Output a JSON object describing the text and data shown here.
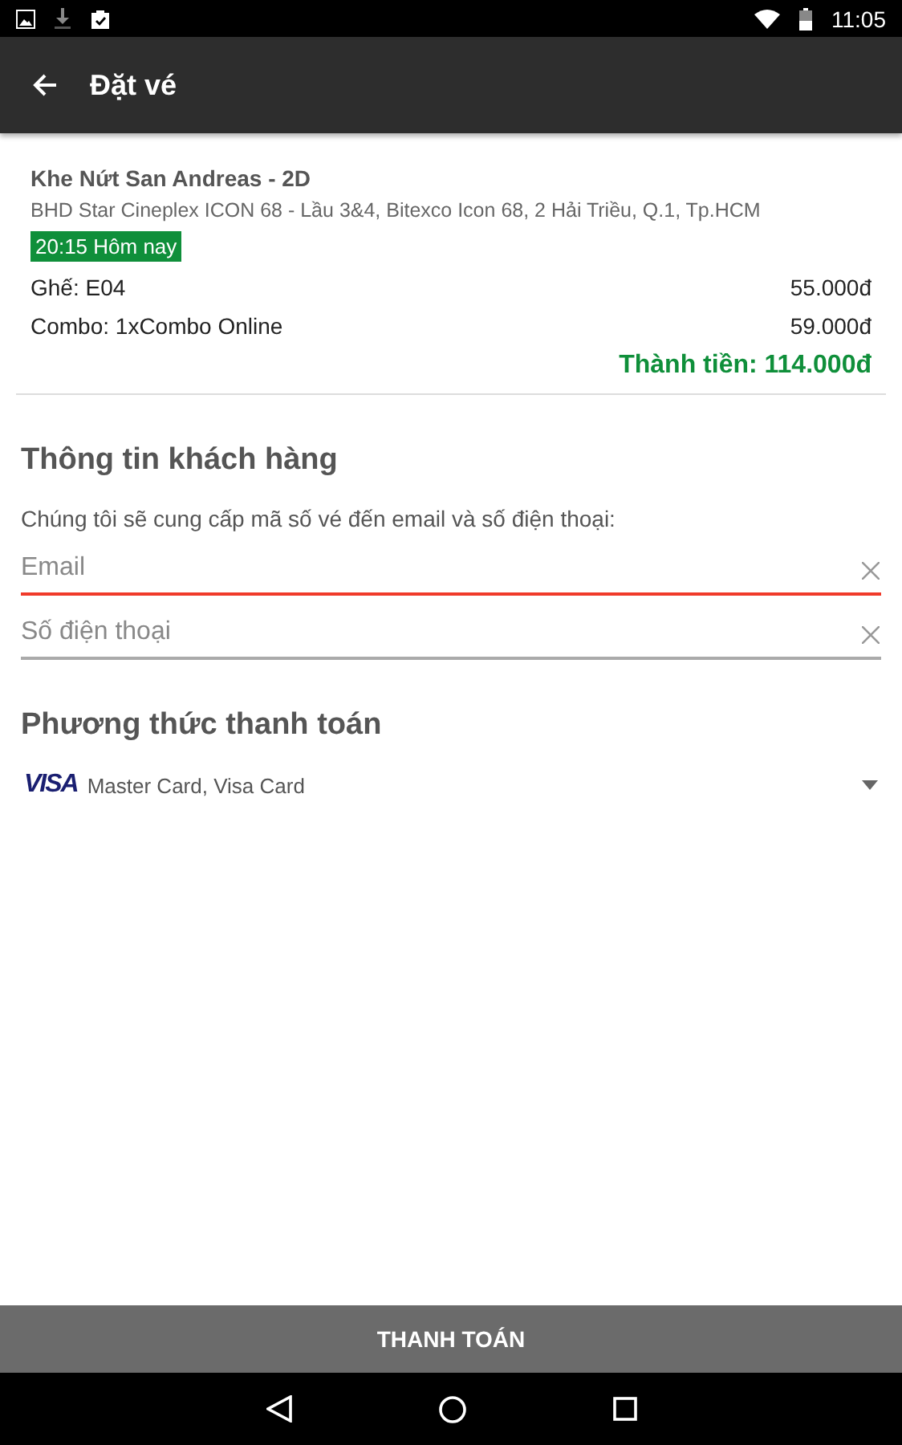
{
  "status_bar": {
    "time": "11:05"
  },
  "app_bar": {
    "title": "Đặt vé"
  },
  "booking": {
    "movie": "Khe Nứt San Andreas - 2D",
    "cinema": "BHD Star Cineplex ICON 68 - Lầu 3&4, Bitexco Icon 68, 2 Hải Triều, Q.1, Tp.HCM",
    "showtime": "20:15 Hôm nay",
    "lines": [
      {
        "label": "Ghế: E04",
        "price": "55.000đ"
      },
      {
        "label": "Combo: 1xCombo Online",
        "price": "59.000đ"
      }
    ],
    "total": "Thành tiền: 114.000đ"
  },
  "customer": {
    "heading": "Thông tin khách hàng",
    "note": "Chúng tôi sẽ cung cấp mã số vé đến email và số điện thoại:",
    "fields": [
      {
        "placeholder": "Email",
        "focused": true
      },
      {
        "placeholder": "Số điện thoại",
        "focused": false
      }
    ]
  },
  "payment": {
    "heading": "Phương thức thanh toán",
    "logo": "VISA",
    "method": "Master Card, Visa Card"
  },
  "pay_button": "THANH TOÁN"
}
